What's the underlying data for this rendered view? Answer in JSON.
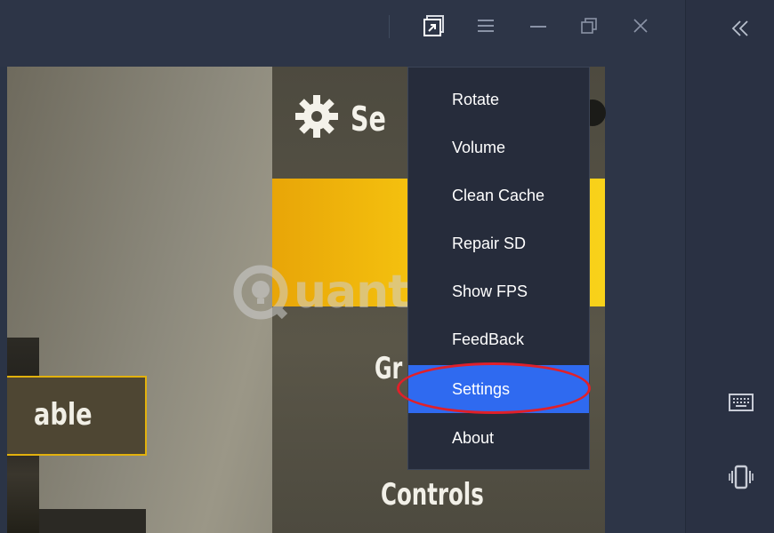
{
  "window": {
    "controls": [
      "screenshot-icon",
      "menu-icon",
      "minimize-icon",
      "restore-icon",
      "close-icon"
    ]
  },
  "sidebar": {
    "icons": [
      "collapse-icon",
      "keyboard-icon",
      "shake-icon"
    ]
  },
  "game": {
    "settings_title": "Se",
    "enable_label": "able",
    "graphics_partial": "Gr",
    "controls_label": "Controls"
  },
  "watermark": {
    "text": "uantrimang"
  },
  "menu": {
    "items": [
      {
        "label": "Rotate"
      },
      {
        "label": "Volume"
      },
      {
        "label": "Clean Cache"
      },
      {
        "label": "Repair SD"
      },
      {
        "label": "Show FPS"
      },
      {
        "label": "FeedBack"
      },
      {
        "label": "Settings",
        "selected": true
      },
      {
        "label": "About"
      }
    ]
  },
  "colors": {
    "accent": "#2f6af0",
    "highlight": "#e0202a",
    "game_yellow": "#f4c00e"
  }
}
